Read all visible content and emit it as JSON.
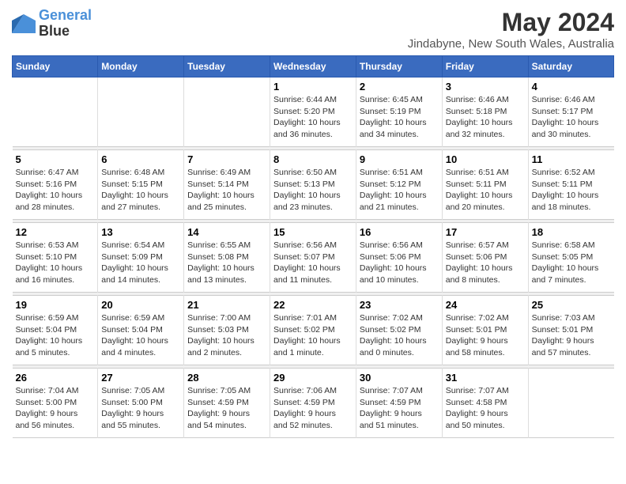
{
  "header": {
    "logo_line1": "General",
    "logo_line2": "Blue",
    "title": "May 2024",
    "subtitle": "Jindabyne, New South Wales, Australia"
  },
  "weekdays": [
    "Sunday",
    "Monday",
    "Tuesday",
    "Wednesday",
    "Thursday",
    "Friday",
    "Saturday"
  ],
  "weeks": [
    {
      "days": [
        {
          "num": "",
          "info": ""
        },
        {
          "num": "",
          "info": ""
        },
        {
          "num": "",
          "info": ""
        },
        {
          "num": "1",
          "info": "Sunrise: 6:44 AM\nSunset: 5:20 PM\nDaylight: 10 hours\nand 36 minutes."
        },
        {
          "num": "2",
          "info": "Sunrise: 6:45 AM\nSunset: 5:19 PM\nDaylight: 10 hours\nand 34 minutes."
        },
        {
          "num": "3",
          "info": "Sunrise: 6:46 AM\nSunset: 5:18 PM\nDaylight: 10 hours\nand 32 minutes."
        },
        {
          "num": "4",
          "info": "Sunrise: 6:46 AM\nSunset: 5:17 PM\nDaylight: 10 hours\nand 30 minutes."
        }
      ]
    },
    {
      "days": [
        {
          "num": "5",
          "info": "Sunrise: 6:47 AM\nSunset: 5:16 PM\nDaylight: 10 hours\nand 28 minutes."
        },
        {
          "num": "6",
          "info": "Sunrise: 6:48 AM\nSunset: 5:15 PM\nDaylight: 10 hours\nand 27 minutes."
        },
        {
          "num": "7",
          "info": "Sunrise: 6:49 AM\nSunset: 5:14 PM\nDaylight: 10 hours\nand 25 minutes."
        },
        {
          "num": "8",
          "info": "Sunrise: 6:50 AM\nSunset: 5:13 PM\nDaylight: 10 hours\nand 23 minutes."
        },
        {
          "num": "9",
          "info": "Sunrise: 6:51 AM\nSunset: 5:12 PM\nDaylight: 10 hours\nand 21 minutes."
        },
        {
          "num": "10",
          "info": "Sunrise: 6:51 AM\nSunset: 5:11 PM\nDaylight: 10 hours\nand 20 minutes."
        },
        {
          "num": "11",
          "info": "Sunrise: 6:52 AM\nSunset: 5:11 PM\nDaylight: 10 hours\nand 18 minutes."
        }
      ]
    },
    {
      "days": [
        {
          "num": "12",
          "info": "Sunrise: 6:53 AM\nSunset: 5:10 PM\nDaylight: 10 hours\nand 16 minutes."
        },
        {
          "num": "13",
          "info": "Sunrise: 6:54 AM\nSunset: 5:09 PM\nDaylight: 10 hours\nand 14 minutes."
        },
        {
          "num": "14",
          "info": "Sunrise: 6:55 AM\nSunset: 5:08 PM\nDaylight: 10 hours\nand 13 minutes."
        },
        {
          "num": "15",
          "info": "Sunrise: 6:56 AM\nSunset: 5:07 PM\nDaylight: 10 hours\nand 11 minutes."
        },
        {
          "num": "16",
          "info": "Sunrise: 6:56 AM\nSunset: 5:06 PM\nDaylight: 10 hours\nand 10 minutes."
        },
        {
          "num": "17",
          "info": "Sunrise: 6:57 AM\nSunset: 5:06 PM\nDaylight: 10 hours\nand 8 minutes."
        },
        {
          "num": "18",
          "info": "Sunrise: 6:58 AM\nSunset: 5:05 PM\nDaylight: 10 hours\nand 7 minutes."
        }
      ]
    },
    {
      "days": [
        {
          "num": "19",
          "info": "Sunrise: 6:59 AM\nSunset: 5:04 PM\nDaylight: 10 hours\nand 5 minutes."
        },
        {
          "num": "20",
          "info": "Sunrise: 6:59 AM\nSunset: 5:04 PM\nDaylight: 10 hours\nand 4 minutes."
        },
        {
          "num": "21",
          "info": "Sunrise: 7:00 AM\nSunset: 5:03 PM\nDaylight: 10 hours\nand 2 minutes."
        },
        {
          "num": "22",
          "info": "Sunrise: 7:01 AM\nSunset: 5:02 PM\nDaylight: 10 hours\nand 1 minute."
        },
        {
          "num": "23",
          "info": "Sunrise: 7:02 AM\nSunset: 5:02 PM\nDaylight: 10 hours\nand 0 minutes."
        },
        {
          "num": "24",
          "info": "Sunrise: 7:02 AM\nSunset: 5:01 PM\nDaylight: 9 hours\nand 58 minutes."
        },
        {
          "num": "25",
          "info": "Sunrise: 7:03 AM\nSunset: 5:01 PM\nDaylight: 9 hours\nand 57 minutes."
        }
      ]
    },
    {
      "days": [
        {
          "num": "26",
          "info": "Sunrise: 7:04 AM\nSunset: 5:00 PM\nDaylight: 9 hours\nand 56 minutes."
        },
        {
          "num": "27",
          "info": "Sunrise: 7:05 AM\nSunset: 5:00 PM\nDaylight: 9 hours\nand 55 minutes."
        },
        {
          "num": "28",
          "info": "Sunrise: 7:05 AM\nSunset: 4:59 PM\nDaylight: 9 hours\nand 54 minutes."
        },
        {
          "num": "29",
          "info": "Sunrise: 7:06 AM\nSunset: 4:59 PM\nDaylight: 9 hours\nand 52 minutes."
        },
        {
          "num": "30",
          "info": "Sunrise: 7:07 AM\nSunset: 4:59 PM\nDaylight: 9 hours\nand 51 minutes."
        },
        {
          "num": "31",
          "info": "Sunrise: 7:07 AM\nSunset: 4:58 PM\nDaylight: 9 hours\nand 50 minutes."
        },
        {
          "num": "",
          "info": ""
        }
      ]
    }
  ]
}
